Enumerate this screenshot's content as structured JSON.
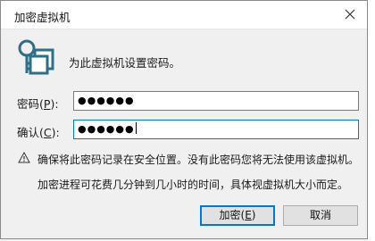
{
  "window": {
    "title": "加密虚拟机"
  },
  "prompt": "为此虚拟机设置密码。",
  "password_field": {
    "label_prefix": "密码(",
    "label_key": "P",
    "label_suffix": "):",
    "value": "●●●●●●"
  },
  "confirm_field": {
    "label_prefix": "确认(",
    "label_key": "C",
    "label_suffix": "):",
    "value": "●●●●●●"
  },
  "warning": "确保将此密码记录在安全位置。没有此密码您将无法使用该虚拟机。",
  "note": "加密进程可花费几分钟到几小时的时间，具体视虚拟机大小而定。",
  "buttons": {
    "encrypt_prefix": "加密(",
    "encrypt_key": "E",
    "encrypt_suffix": ")",
    "cancel": "取消"
  },
  "icons": {
    "title_close": "close-icon",
    "header": "key-lock-icon",
    "warning": "warning-triangle-icon"
  },
  "colors": {
    "focus_border": "#0078d7",
    "icon_teal": "#2c6f86"
  }
}
